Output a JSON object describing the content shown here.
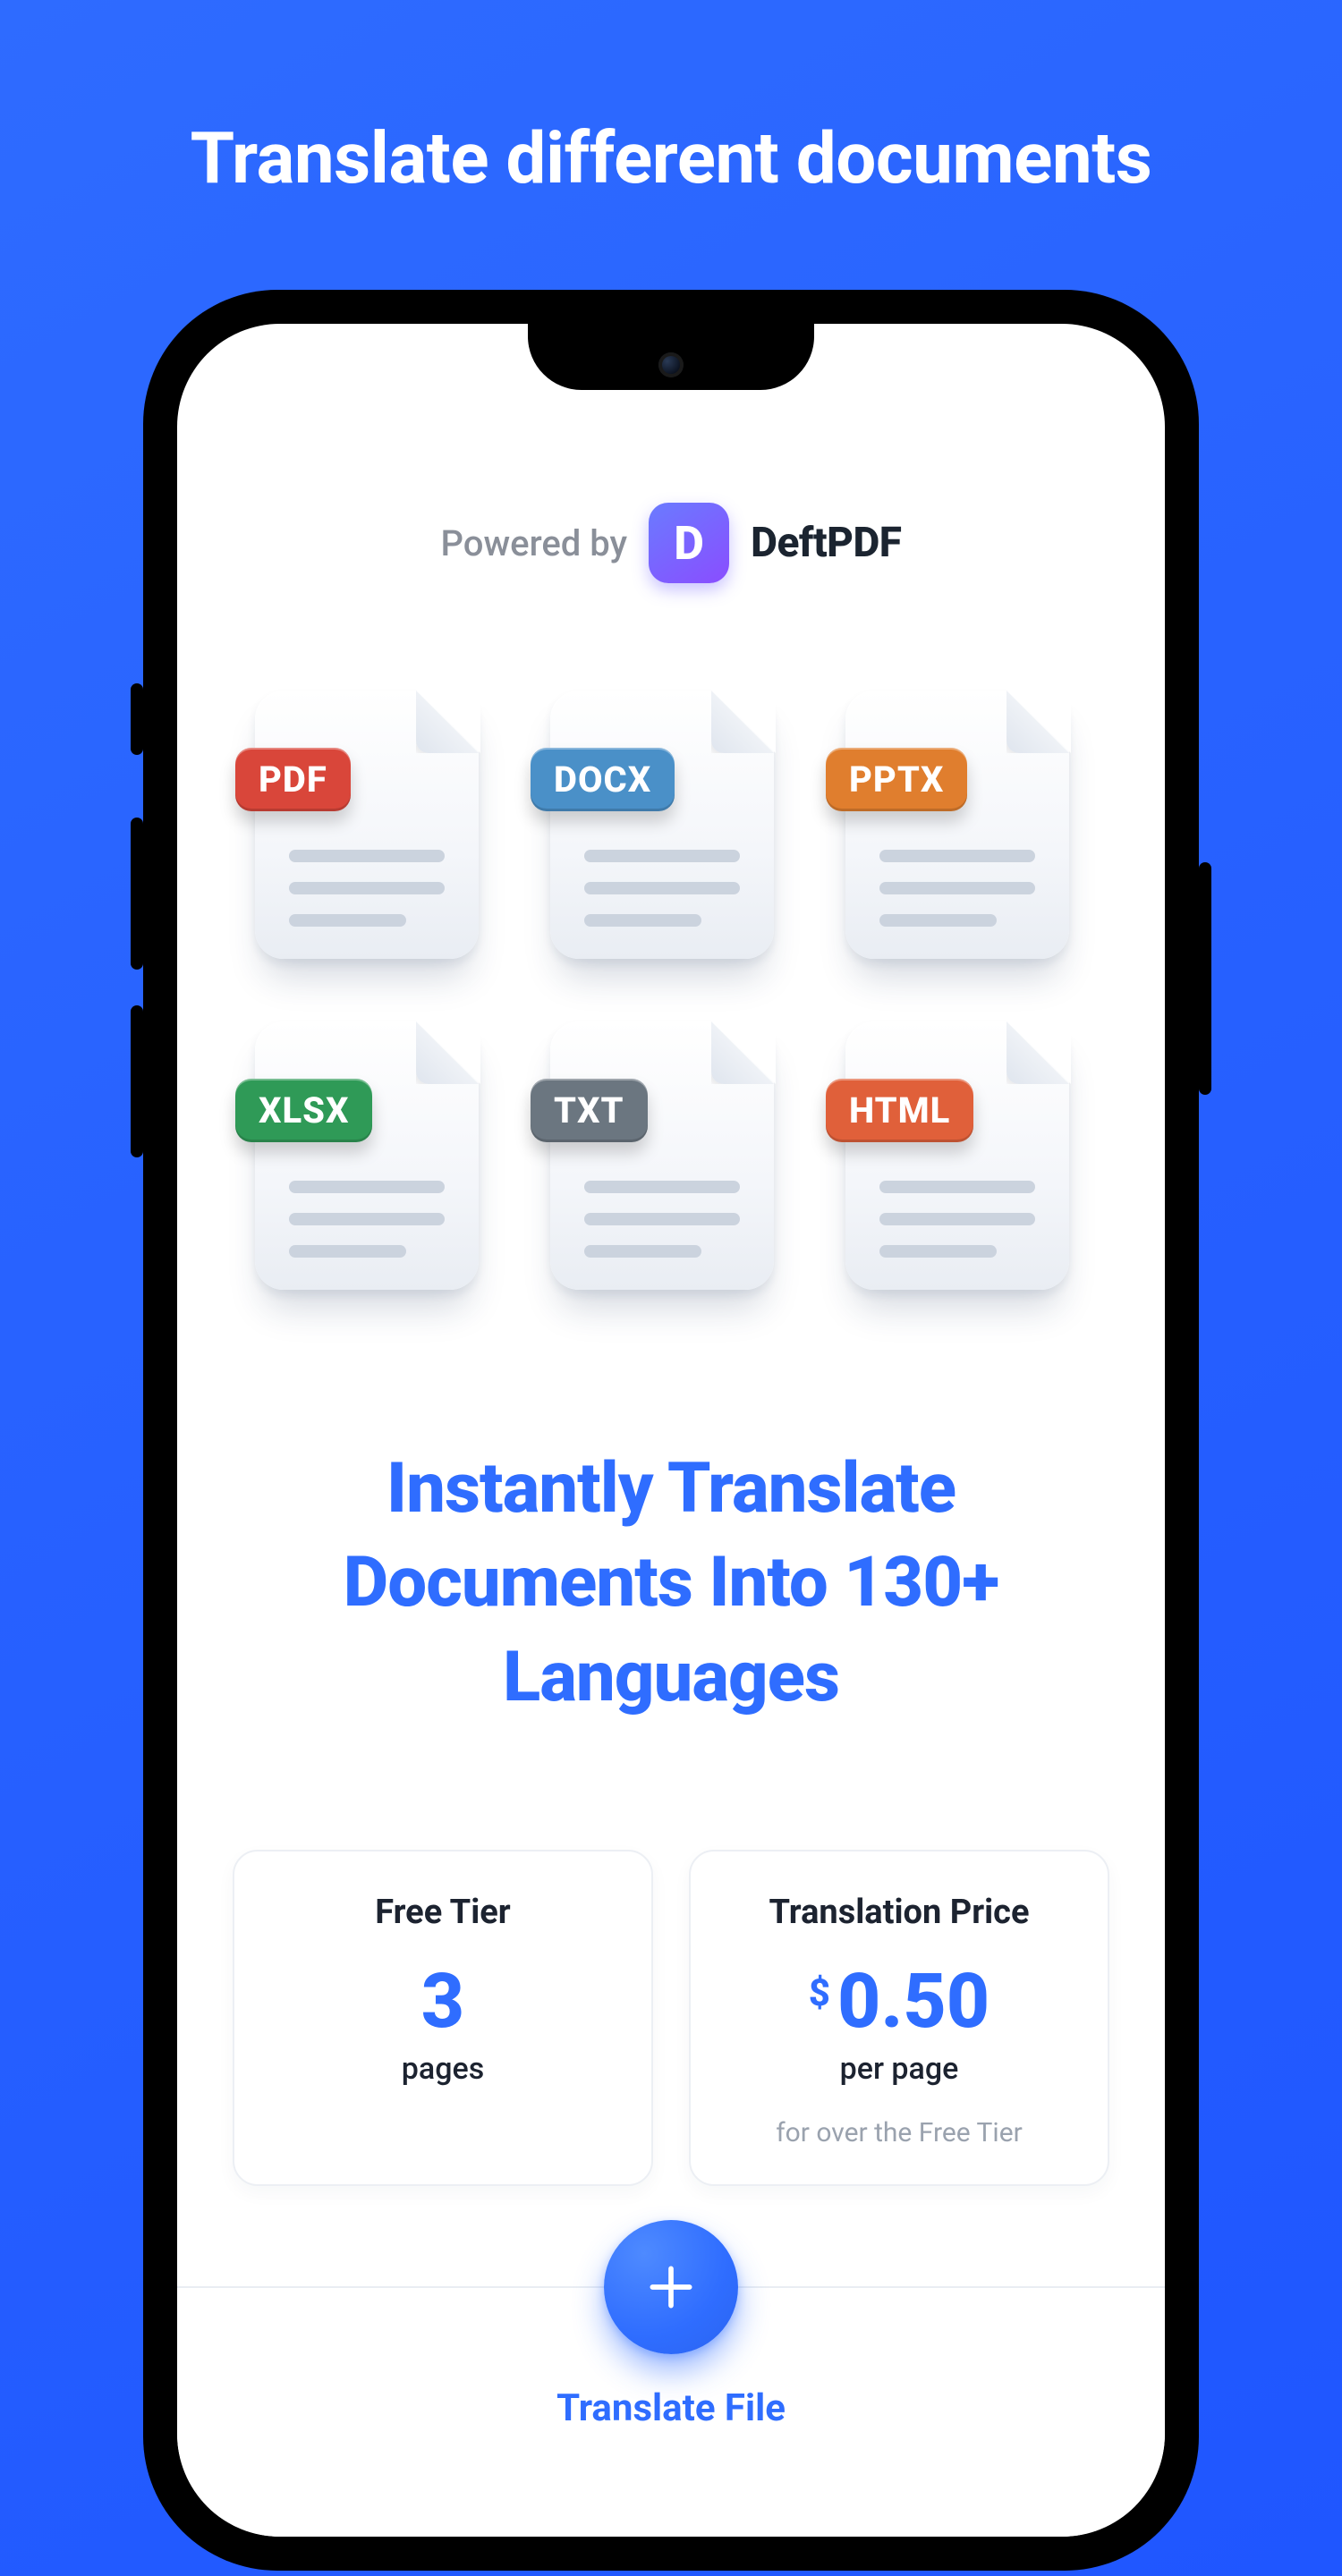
{
  "page_title": "Translate different documents",
  "powered_by_label": "Powered by",
  "brand_name": "DeftPDF",
  "file_types": [
    {
      "label": "PDF",
      "color": "#d9463a"
    },
    {
      "label": "DOCX",
      "color": "#4a90c8"
    },
    {
      "label": "PPTX",
      "color": "#e07e2e"
    },
    {
      "label": "XLSX",
      "color": "#2f9a57"
    },
    {
      "label": "TXT",
      "color": "#6b7680"
    },
    {
      "label": "HTML",
      "color": "#e0603a"
    }
  ],
  "headline": "Instantly Translate Documents Into 130+ Languages",
  "free_tier": {
    "title": "Free Tier",
    "value": "3",
    "unit": "pages"
  },
  "price": {
    "title": "Translation Price",
    "currency": "$",
    "value": "0.50",
    "unit": "per page",
    "fine": "for over the Free Tier"
  },
  "action_label": "Translate File"
}
